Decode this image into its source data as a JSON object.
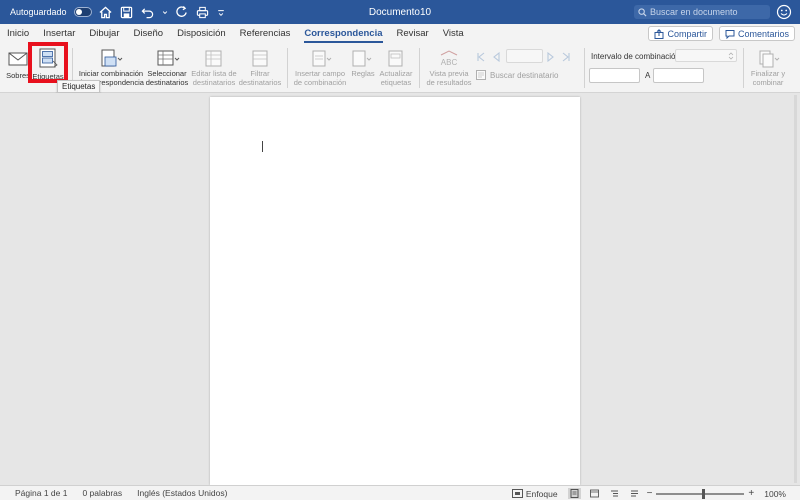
{
  "titlebar": {
    "autosave_label": "Autoguardado",
    "document_title": "Documento10",
    "search_placeholder": "Buscar en documento"
  },
  "tabs": [
    {
      "label": "Inicio"
    },
    {
      "label": "Insertar"
    },
    {
      "label": "Dibujar"
    },
    {
      "label": "Diseño"
    },
    {
      "label": "Disposición"
    },
    {
      "label": "Referencias"
    },
    {
      "label": "Correspondencia",
      "active": true
    },
    {
      "label": "Revisar"
    },
    {
      "label": "Vista"
    }
  ],
  "tab_actions": {
    "share_label": "Compartir",
    "comments_label": "Comentarios"
  },
  "ribbon": {
    "sobres": "Sobres",
    "etiquetas": "Etiquetas",
    "iniciar_combinacion": "Iniciar combinación",
    "iniciar_combinacion_2": "de correspondencia",
    "seleccionar": "Seleccionar",
    "seleccionar_2": "destinatarios",
    "editar_lista": "Editar lista de",
    "editar_lista_2": "destinatarios",
    "filtrar": "Filtrar",
    "filtrar_2": "destinatarios",
    "insertar_campo": "Insertar campo",
    "insertar_campo_2": "de combinación",
    "reglas": "Reglas",
    "actualizar": "Actualizar",
    "actualizar_2": "etiquetas",
    "vista_previa": "Vista previa",
    "vista_previa_2": "de resultados",
    "buscar_destinatario": "Buscar destinatario",
    "intervalo_label": "Intervalo de combinación",
    "a_label": "A",
    "finalizar": "Finalizar y",
    "finalizar_2": "combinar",
    "preview_icon_text": "ABC"
  },
  "tooltip": {
    "text": "Etiquetas"
  },
  "statusbar": {
    "page": "Página 1 de 1",
    "words": "0 palabras",
    "language": "Inglés (Estados Unidos)",
    "focus": "Enfoque",
    "zoom": "100%",
    "zoom_level": 100
  },
  "colors": {
    "accent": "#2b579a",
    "highlight": "#e8101d"
  }
}
